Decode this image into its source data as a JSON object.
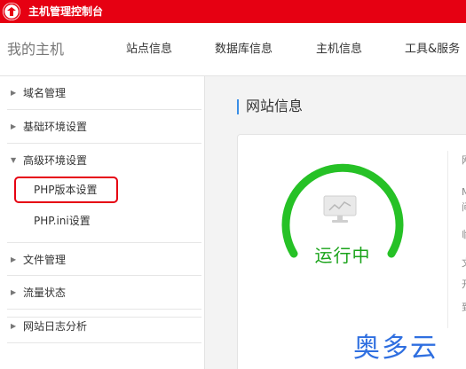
{
  "topbar": {
    "title": "主机管理控制台",
    "logo_icon": "brand-logo"
  },
  "header": {
    "title": "我的主机",
    "nav": [
      "站点信息",
      "数据库信息",
      "主机信息",
      "工具&服务"
    ]
  },
  "sidebar": {
    "items": [
      {
        "label": "域名管理",
        "arrow": "▶"
      },
      {
        "label": "基础环境设置",
        "arrow": "▶"
      },
      {
        "label": "高级环境设置",
        "arrow": "▼"
      },
      {
        "label": "文件管理",
        "arrow": "▶"
      },
      {
        "label": "流量状态",
        "arrow": "▶"
      },
      {
        "label": "网站日志分析",
        "arrow": "▶"
      }
    ],
    "subitems": [
      "PHP版本设置",
      "PHP.ini设置"
    ]
  },
  "main": {
    "section_title": "网站信息",
    "status": "运行中",
    "status_color": "#1aa31a",
    "cut_labels": [
      "网",
      "M",
      "间",
      "临",
      "文",
      "开",
      "到"
    ]
  },
  "watermark": "奥多云"
}
